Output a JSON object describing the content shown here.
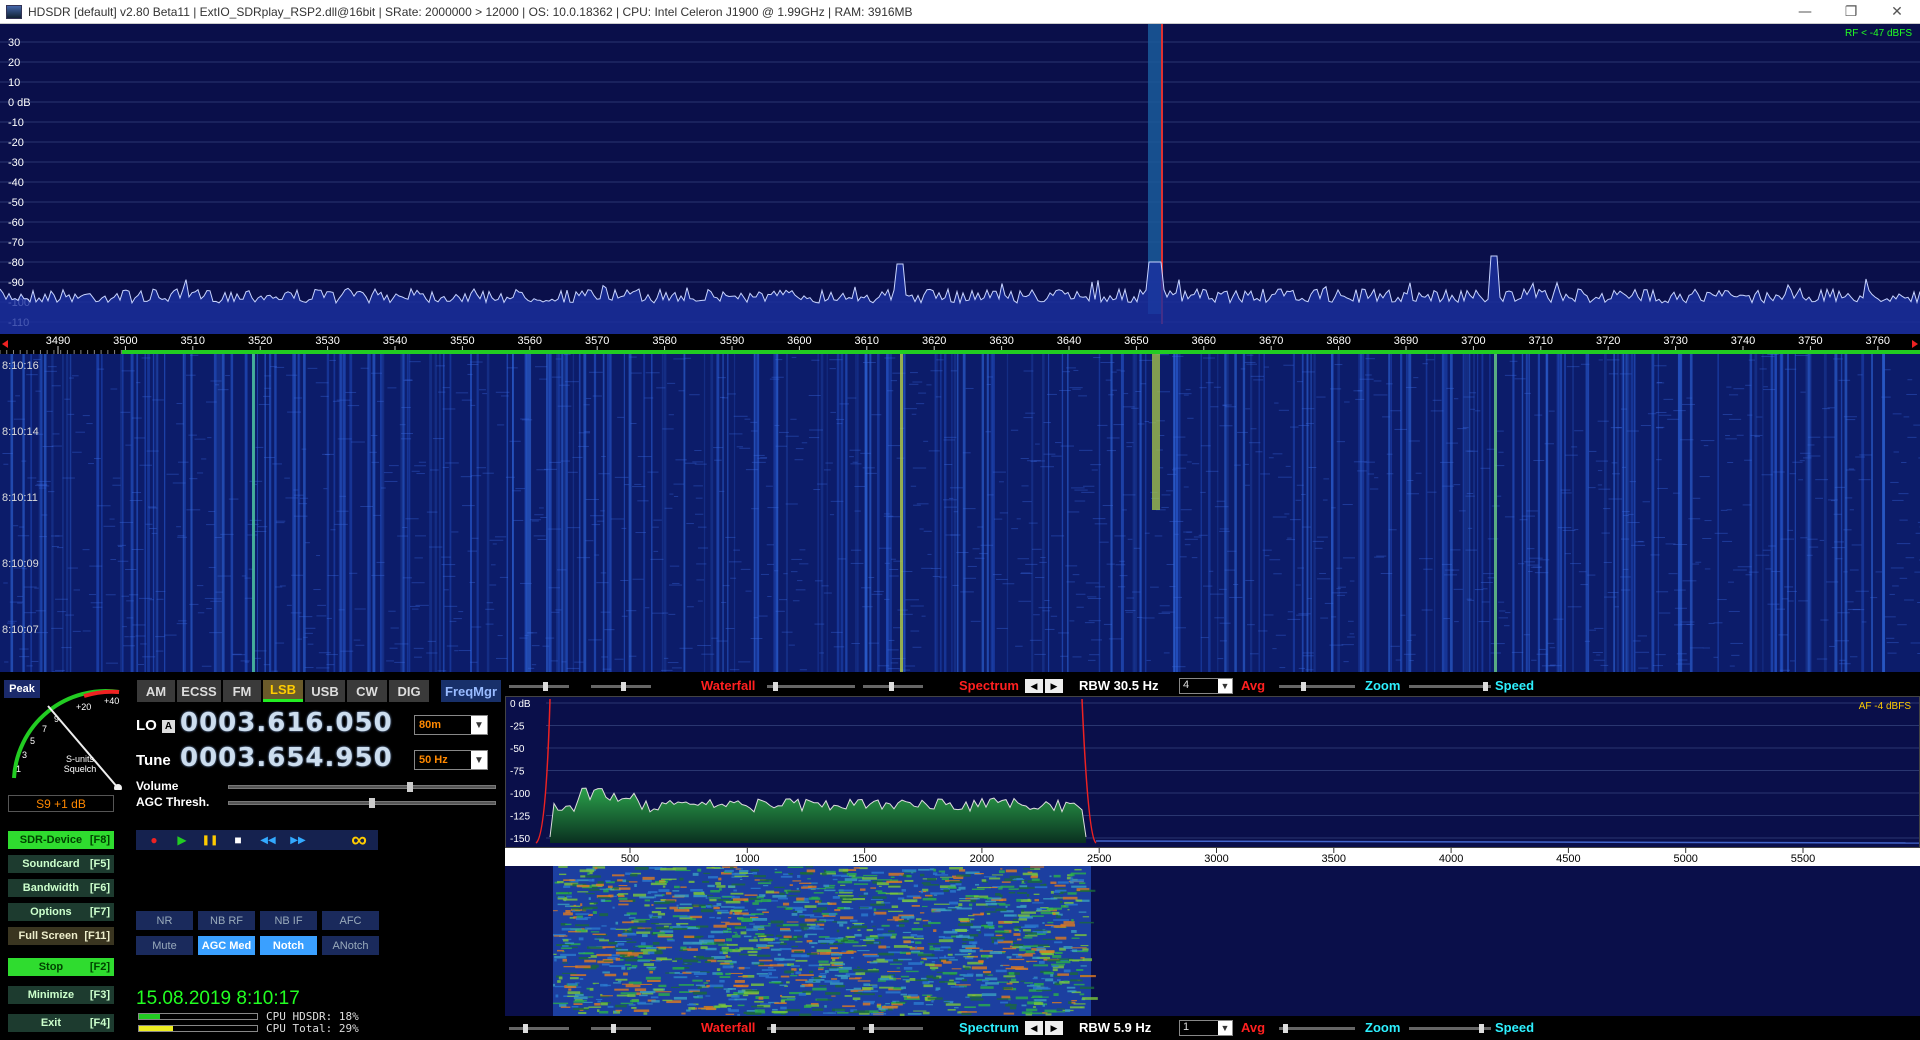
{
  "titlebar": {
    "title": "HDSDR  [default]  v2.80 Beta11  |  ExtIO_SDRplay_RSP2.dll@16bit  |  SRate: 2000000 > 12000  |  OS: 10.0.18362   |  CPU: Intel Celeron  J1900  @ 1.99GHz  |  RAM: 3916MB",
    "minimize_glyph": "—",
    "restore_glyph": "❐",
    "close_glyph": "✕"
  },
  "rf_spectrum": {
    "level_readout": "RF < -47 dBFS",
    "db_labels": [
      "30",
      "20",
      "10",
      "0 dB",
      "-10",
      "-20",
      "-30",
      "-40",
      "-50",
      "-60",
      "-70",
      "-80",
      "-90",
      "-100",
      "-110"
    ]
  },
  "rf_axis": {
    "labels": [
      "3490",
      "3500",
      "3510",
      "3520",
      "3530",
      "3540",
      "3550",
      "3560",
      "3570",
      "3580",
      "3590",
      "3600",
      "3610",
      "3620",
      "3630",
      "3640",
      "3650",
      "3660",
      "3670",
      "3680",
      "3690",
      "3700",
      "3710",
      "3720",
      "3730",
      "3740",
      "3750",
      "3760"
    ]
  },
  "rf_waterfall": {
    "timestamps": [
      "8:10:16",
      "8:10:14",
      "8:10:11",
      "8:10:09",
      "8:10:07"
    ]
  },
  "smeter": {
    "peak_label": "Peak",
    "scale": [
      "1",
      "3",
      "5",
      "7",
      "9",
      "+20",
      "+40"
    ],
    "caption_top": "S-units",
    "caption_bottom": "Squelch",
    "reading": "S9 +1 dB"
  },
  "modes": {
    "am": "AM",
    "ecss": "ECSS",
    "fm": "FM",
    "lsb": "LSB",
    "usb": "USB",
    "cw": "CW",
    "dig": "DIG",
    "freqmgr": "FreqMgr"
  },
  "tuning": {
    "lo_label": "LO",
    "lo_tag": "A",
    "lo_freq": "0003.616.050",
    "band": "80m",
    "tune_label": "Tune",
    "tune_freq": "0003.654.950",
    "step": "50 Hz",
    "volume_label": "Volume",
    "agc_label": "AGC Thresh."
  },
  "sidebar": {
    "sdr_device": {
      "name": "SDR-Device",
      "key": "[F8]"
    },
    "soundcard": {
      "name": "Soundcard",
      "key": "[F5]"
    },
    "bandwidth": {
      "name": "Bandwidth",
      "key": "[F6]"
    },
    "options": {
      "name": "Options",
      "key": "[F7]"
    },
    "fullscreen": {
      "name": "Full Screen",
      "key": "[F11]"
    },
    "stop": {
      "name": "Stop",
      "key": "[F2]"
    },
    "minimize": {
      "name": "Minimize",
      "key": "[F3]"
    },
    "exit": {
      "name": "Exit",
      "key": "[F4]"
    }
  },
  "playback": {
    "record": "●",
    "play": "▶",
    "pause": "❚❚",
    "stop": "■",
    "rewind": "◀◀",
    "forward": "▶▶",
    "loop": "∞"
  },
  "dsp": {
    "nr": "NR",
    "nb_rf": "NB RF",
    "nb_if": "NB IF",
    "afc": "AFC",
    "mute": "Mute",
    "agc_med": "AGC Med",
    "notch": "Notch",
    "anotch": "ANotch"
  },
  "status": {
    "datetime": "15.08.2019 8:10:17",
    "cpu_hdsdr": "CPU HDSDR: 18%",
    "cpu_total": "CPU Total: 29%",
    "cpu_hdsdr_level": 0.18,
    "cpu_total_level": 0.29
  },
  "rf_controls": {
    "waterfall": "Waterfall",
    "spectrum": "Spectrum",
    "nav_left": "◀",
    "nav_right": "▶",
    "rbw": "RBW 30.5 Hz",
    "avg_value": "4",
    "avg": "Avg",
    "zoom": "Zoom",
    "speed": "Speed"
  },
  "af_spectrum": {
    "level_readout": "AF  -4 dBFS",
    "db_labels": [
      "0 dB",
      "-25",
      "-50",
      "-75",
      "-100",
      "-125",
      "-150"
    ]
  },
  "af_axis": {
    "labels": [
      "500",
      "1000",
      "1500",
      "2000",
      "2500",
      "3000",
      "3500",
      "4000",
      "4500",
      "5000",
      "5500"
    ]
  },
  "af_controls": {
    "waterfall": "Waterfall",
    "spectrum": "Spectrum",
    "nav_left": "◀",
    "nav_right": "▶",
    "rbw": "RBW  5.9 Hz",
    "avg_value": "1",
    "avg": "Avg",
    "zoom": "Zoom",
    "speed": "Speed"
  },
  "colors": {
    "spectrum_bg": "#0a0f4a",
    "waterfall_bg": "#0c1c6a",
    "accent_green": "#2fdc2f",
    "label_red": "#ff2020",
    "label_cyan": "#2ef0ff",
    "freq_orange": "#ff8800"
  }
}
